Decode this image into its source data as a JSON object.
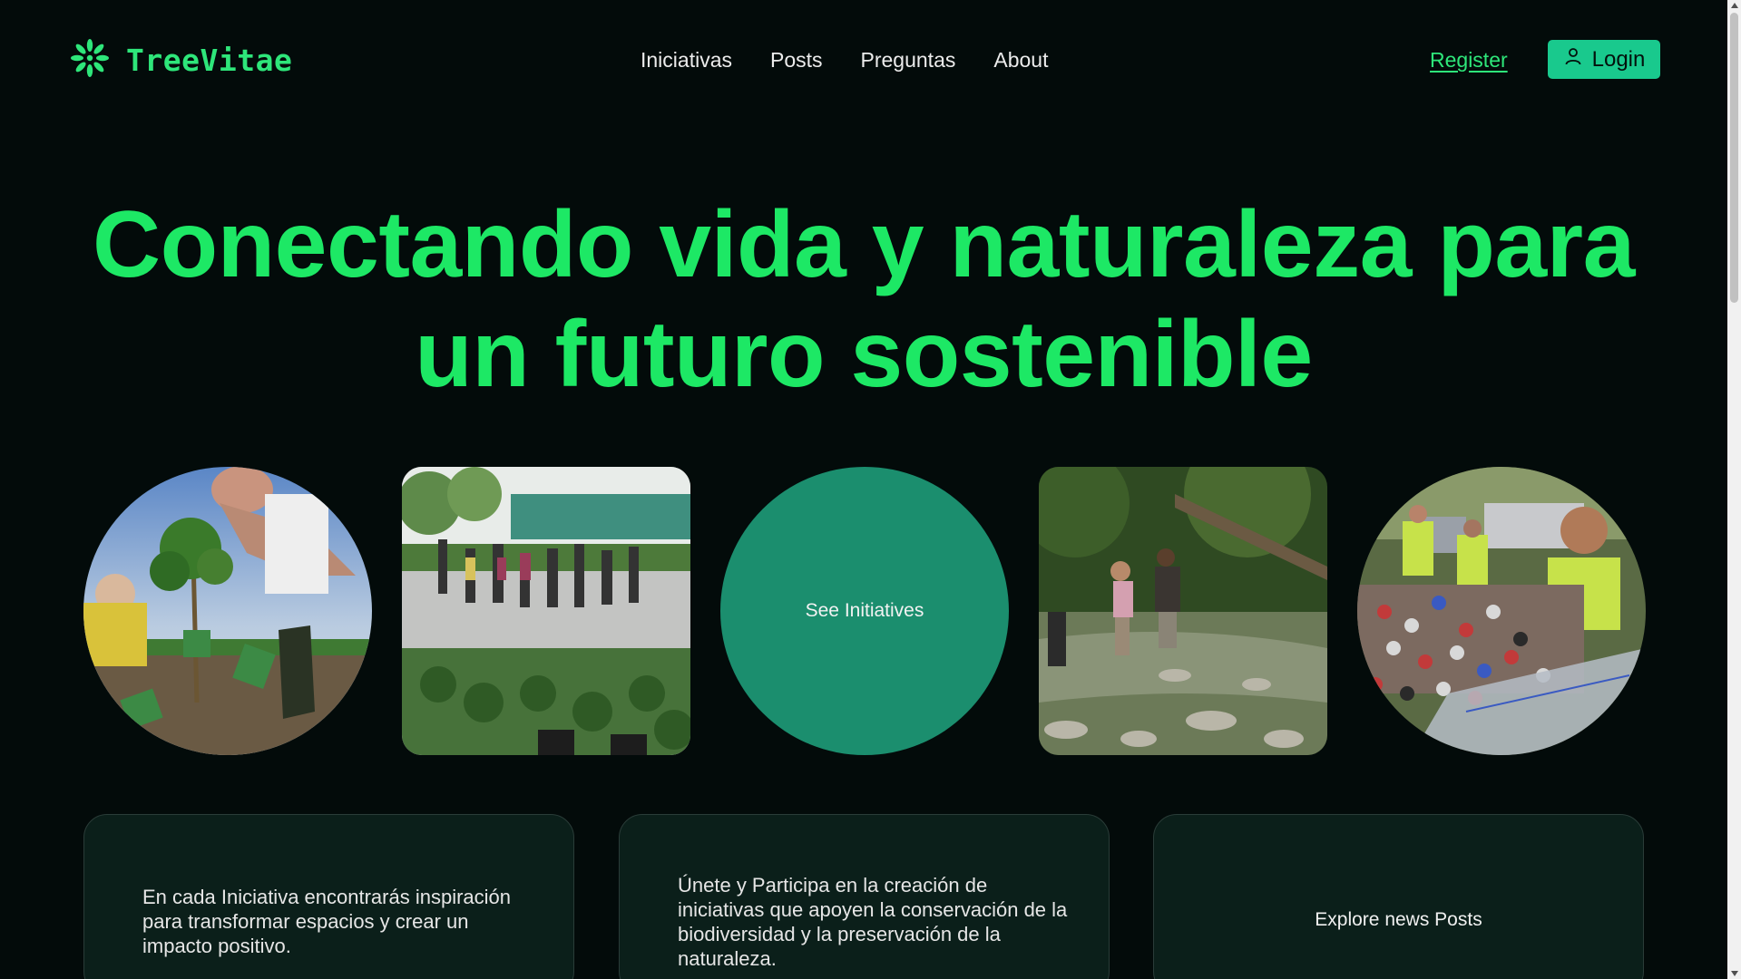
{
  "header": {
    "brand": "TreeVitae",
    "logo_icon": "leaf-burst-icon",
    "nav": [
      "Iniciativas",
      "Posts",
      "Preguntas",
      "About"
    ],
    "register_label": "Register",
    "login_label": "Login",
    "login_icon": "user-icon"
  },
  "hero": {
    "title_line1": "Conectando vida y naturaleza para",
    "title_line2": "un futuro sostenible"
  },
  "tiles": {
    "photos": [
      "planting-tree-photo",
      "plant-nursery-photo",
      "river-cleanup-photo",
      "recycling-cans-photo"
    ],
    "center_button": "See Initiatives"
  },
  "cards": [
    {
      "text": "En cada Iniciativa encontrarás inspiración para transformar espacios y crear un impacto positivo."
    },
    {
      "text": "Únete y Participa en la creación de iniciativas que apoyen la conservación de la biodiversidad y la preservación de la naturaleza."
    },
    {
      "link": "Explore news Posts"
    }
  ],
  "colors": {
    "background": "#030b0a",
    "accent_green": "#1de865",
    "button_teal": "#19c98d",
    "circle_teal": "#1b8e6e",
    "card_bg": "#0b1f1a"
  }
}
